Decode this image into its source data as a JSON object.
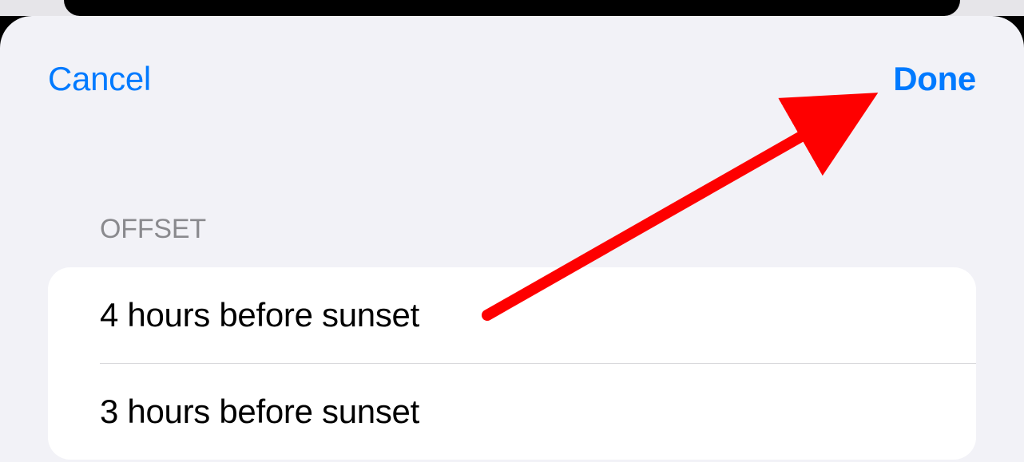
{
  "nav": {
    "cancel_label": "Cancel",
    "done_label": "Done"
  },
  "section": {
    "header": "OFFSET"
  },
  "options": [
    {
      "label": "4 hours before sunset"
    },
    {
      "label": "3 hours before sunset"
    }
  ],
  "colors": {
    "accent": "#007aff",
    "sheet_bg": "#f2f2f7",
    "list_bg": "#ffffff",
    "header_text": "#8a8a8e",
    "annotation": "#fe0000"
  }
}
